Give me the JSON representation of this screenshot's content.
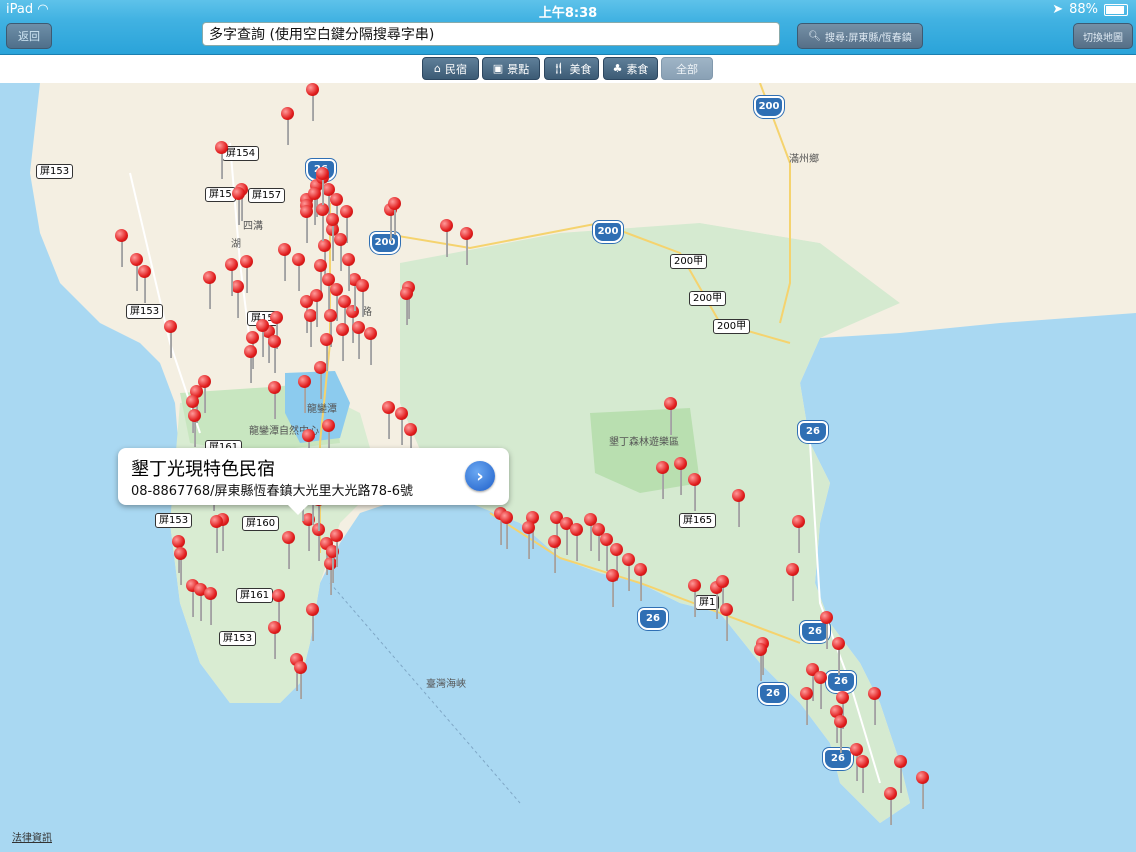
{
  "status_bar": {
    "device": "iPad",
    "time": "上午8:38",
    "battery": "88%",
    "battery_level": 0.88
  },
  "nav": {
    "back_label": "返回",
    "search_value": "多字查詢 (使用空白鍵分隔搜尋字串)",
    "search_button_label": "搜尋:屏東縣/恆春鎮",
    "switch_map_label": "切換地圖"
  },
  "categories": [
    {
      "label": "民宿",
      "icon": "house-icon"
    },
    {
      "label": "景點",
      "icon": "picture-icon"
    },
    {
      "label": "美食",
      "icon": "utensils-icon"
    },
    {
      "label": "素食",
      "icon": "vegetable-icon"
    },
    {
      "label": "全部",
      "icon": "none"
    }
  ],
  "map": {
    "road_labels": [
      "屏153",
      "屏154",
      "屏157",
      "屏15",
      "屏153",
      "屏161",
      "屏153",
      "屏160",
      "屏161",
      "屏153",
      "屏165",
      "200甲",
      "200甲",
      "200甲",
      "屏1",
      "屏15"
    ],
    "shields": [
      "26",
      "200",
      "200",
      "200",
      "26",
      "26",
      "26",
      "26",
      "26",
      "26"
    ],
    "places": [
      "滿州鄉",
      "龍鑾潭",
      "龍鑾潭自然中心",
      "墾丁森林遊樂區",
      "臺灣海峽",
      "四溝",
      "湖",
      "路"
    ]
  },
  "callout": {
    "title": "墾丁光現特色民宿",
    "subtitle": "08-8867768/屏東縣恆春鎮大光里大光路78-6號"
  },
  "legal_label": "法律資訊"
}
